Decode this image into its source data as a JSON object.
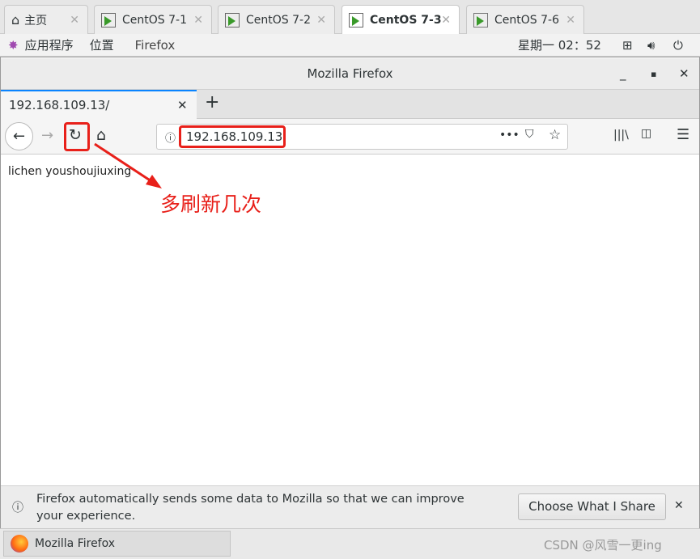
{
  "vm_tabs": [
    {
      "label": "主页",
      "icon": "home-icon"
    },
    {
      "label": "CentOS 7-1",
      "icon": "vm-running-icon"
    },
    {
      "label": "CentOS 7-2",
      "icon": "vm-running-icon"
    },
    {
      "label": "CentOS 7-3",
      "icon": "vm-running-icon",
      "active": true
    },
    {
      "label": "CentOS 7-6",
      "icon": "vm-icon"
    }
  ],
  "topbar": {
    "applications": "应用程序",
    "places": "位置",
    "app": "Firefox",
    "clock": "星期一 02：52"
  },
  "window": {
    "title": "Mozilla Firefox"
  },
  "browser": {
    "tab_title": "192.168.109.13/",
    "url": "192.168.109.13",
    "page_text": "lichen  youshoujiuxing"
  },
  "annotation": {
    "text": "多刷新几次",
    "color": "#e8201a"
  },
  "notification": {
    "text": "Firefox automatically sends some data to Mozilla so that we can improve your experience.",
    "button": "Choose What I Share"
  },
  "taskbar": {
    "item": "Mozilla Firefox",
    "watermark": "CSDN @风雪一更ing"
  }
}
